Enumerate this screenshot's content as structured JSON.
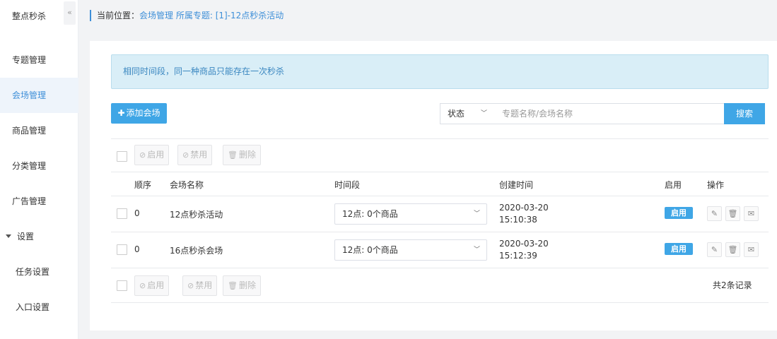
{
  "sidebar": {
    "title": "整点秒杀",
    "collapse_icon": "«",
    "items": [
      {
        "label": "专题管理"
      },
      {
        "label": "会场管理"
      },
      {
        "label": "商品管理"
      },
      {
        "label": "分类管理"
      },
      {
        "label": "广告管理"
      }
    ],
    "group": {
      "label": "设置"
    },
    "subitems": [
      {
        "label": "任务设置"
      },
      {
        "label": "入口设置"
      }
    ]
  },
  "breadcrumb": {
    "prefix": "当前位置：",
    "path": "会场管理 所属专题: [1]-12点秒杀活动"
  },
  "alert": {
    "text": "相同时间段，同一种商品只能存在一次秒杀"
  },
  "toolbar": {
    "add_label": "添加会场",
    "status_label": "状态",
    "search_placeholder": "专题名称/会场名称",
    "search_label": "搜索"
  },
  "bulk": {
    "enable": "启用",
    "disable": "禁用",
    "delete": "删除"
  },
  "table": {
    "columns": [
      "顺序",
      "会场名称",
      "时间段",
      "创建时间",
      "启用",
      "操作"
    ],
    "rows": [
      {
        "order": "0",
        "name": "12点秒杀活动",
        "period": "12点: 0个商品",
        "date": "2020-03-20",
        "time": "15:10:38",
        "status": "启用"
      },
      {
        "order": "0",
        "name": "16点秒杀会场",
        "period": "12点: 0个商品",
        "date": "2020-03-20",
        "time": "15:12:39",
        "status": "启用"
      }
    ],
    "total": "共2条记录"
  },
  "colors": {
    "accent": "#3fa6e6",
    "active_text": "#3e8fd8",
    "alert_bg": "#d9eef7"
  }
}
